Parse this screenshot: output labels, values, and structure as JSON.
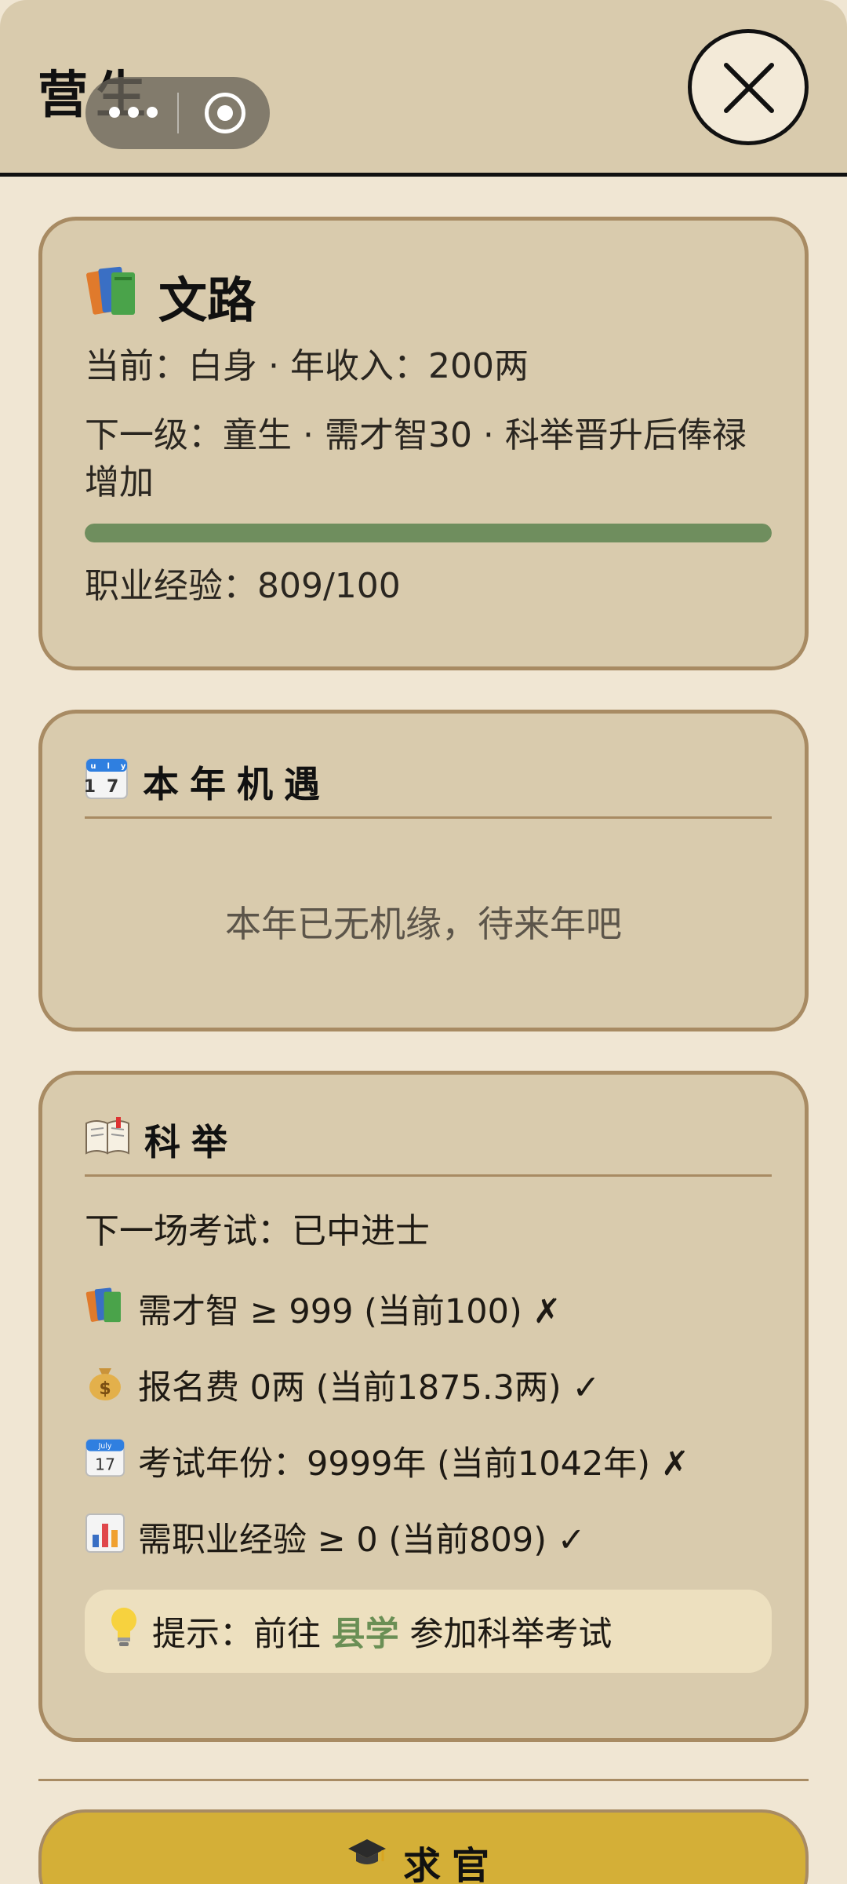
{
  "header": {
    "title": "营生"
  },
  "career": {
    "title": "文路",
    "icon": "books-icon",
    "current_line": "当前：白身 · 年收入：200两",
    "next_line": "下一级：童生 · 需才智30 · 科举晋升后俸禄增加",
    "experience_line": "职业经验：809/100",
    "experience_progress": 1.0
  },
  "opportunities": {
    "title": "本年机遇",
    "icon": "calendar-icon",
    "empty_message": "本年已无机缘，待来年吧"
  },
  "exam": {
    "title": "科举",
    "icon": "open-book-icon",
    "next_exam": "下一场考试：已中进士",
    "requirements": [
      {
        "icon": "books-icon",
        "text": "需才智 ≥ 999 (当前100) ✗"
      },
      {
        "icon": "money-bag-icon",
        "text": "报名费 0两 (当前1875.3两) ✓"
      },
      {
        "icon": "calendar-icon",
        "text": "考试年份：9999年 (当前1042年) ✗"
      },
      {
        "icon": "bar-chart-icon",
        "text": "需职业经验 ≥ 0 (当前809) ✓"
      }
    ],
    "tip_prefix": "提示：前往 ",
    "tip_link": "县学",
    "tip_suffix": " 参加科举考试",
    "tip_icon": "light-bulb-icon"
  },
  "actions": {
    "seek_office_label": "求官",
    "seek_office_icon": "graduation-cap-icon"
  },
  "colors": {
    "header_bg": "#d9cbad",
    "card_bg": "#d9cbad",
    "card_border": "#a88b63",
    "progress_fill": "#6f8e5e",
    "link_green": "#6a8f55",
    "button_gold": "#d4af37"
  }
}
